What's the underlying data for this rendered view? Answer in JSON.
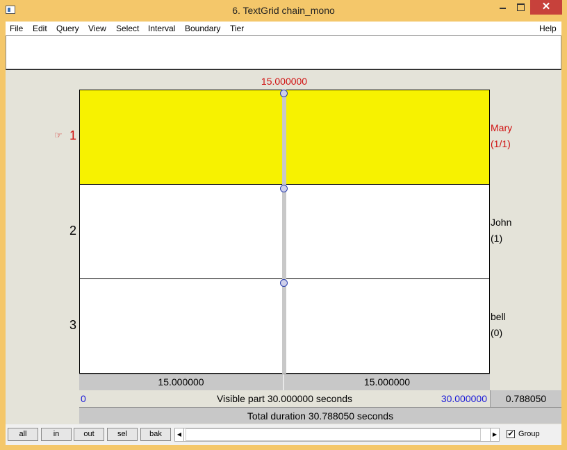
{
  "window": {
    "title": "6. TextGrid chain_mono",
    "close_glyph": "✕"
  },
  "menu": {
    "items": [
      "File",
      "Edit",
      "Query",
      "View",
      "Select",
      "Interval",
      "Boundary",
      "Tier"
    ],
    "help": "Help"
  },
  "editor": {
    "cursor_time": "15.000000",
    "selected_tier_pointer": "☞",
    "tiers": [
      {
        "number": "1",
        "name": "Mary",
        "count": "(1/1)",
        "selected": true
      },
      {
        "number": "2",
        "name": "John",
        "count": "(1)",
        "selected": false
      },
      {
        "number": "3",
        "name": "bell",
        "count": "(0)",
        "selected": false
      }
    ],
    "intervals": [
      "15.000000",
      "15.000000"
    ],
    "visible_start": "0",
    "visible_label": "Visible part 30.000000 seconds",
    "visible_end": "30.000000",
    "visible_rest": "0.788050",
    "total_duration": "Total duration 30.788050 seconds"
  },
  "controls": {
    "buttons": [
      "all",
      "in",
      "out",
      "sel",
      "bak"
    ],
    "scroll_left": "◀",
    "scroll_right": "▶",
    "group_checked": "✔",
    "group_label": "Group"
  }
}
